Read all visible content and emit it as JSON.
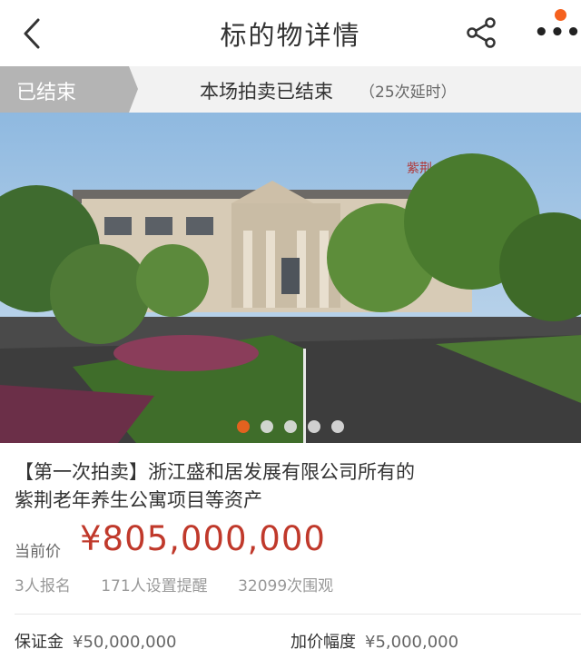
{
  "header": {
    "title": "标的物详情"
  },
  "status": {
    "tag": "已结束",
    "text": "本场拍卖已结束",
    "extensions": "（25次延时）"
  },
  "gallery": {
    "image_label": "紫荆",
    "slides": 5,
    "active_slide": 1
  },
  "item": {
    "title": "【第一次拍卖】浙江盛和居发展有限公司所有的紫荆老年养生公寓项目等资产",
    "price_label": "当前价",
    "price_value": "¥805,000,000",
    "stats": {
      "signups": "3人报名",
      "reminders": "171人设置提醒",
      "views": "32099次围观"
    },
    "deposit_label": "保证金",
    "deposit_value": "¥50,000,000",
    "increment_label": "加价幅度",
    "increment_value": "¥5,000,000"
  },
  "colors": {
    "accent": "#f5611e",
    "price": "#c0392b",
    "tag_bg": "#b4b4b4"
  }
}
